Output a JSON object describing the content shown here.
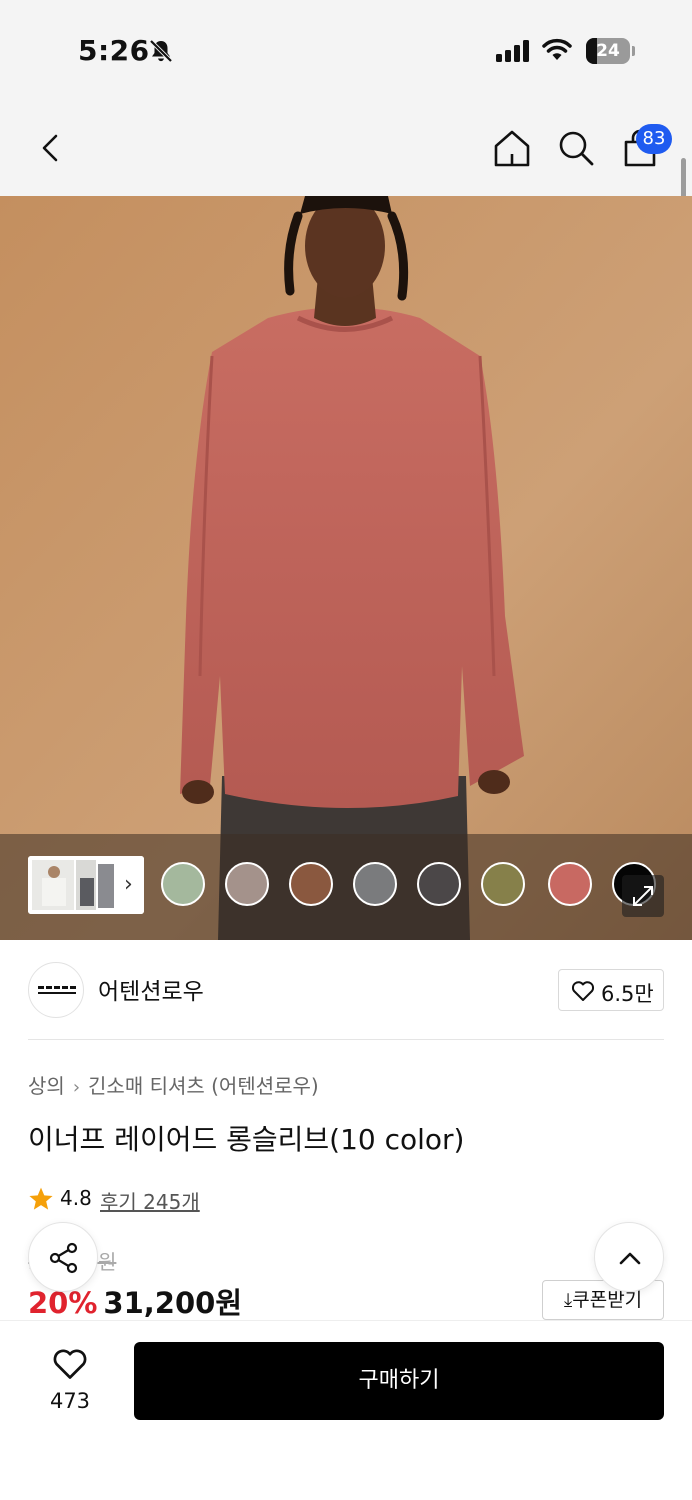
{
  "status_bar": {
    "time": "5:26",
    "battery": "24",
    "battery_level": 0.24
  },
  "nav": {
    "cart_count": "83",
    "badge_color": "#1f5bf0"
  },
  "gallery": {
    "swatches": [
      {
        "color": "#a4b89d"
      },
      {
        "color": "#a4928b"
      },
      {
        "color": "#8a583f"
      },
      {
        "color": "#7a7b7d"
      },
      {
        "color": "#4b4748"
      },
      {
        "color": "#86804a"
      },
      {
        "color": "#c86962"
      },
      {
        "color": "#050505"
      }
    ]
  },
  "brand": {
    "name": "어텐션로우",
    "logo_text": "ATTENTIONROW",
    "likes": "6.5만"
  },
  "product": {
    "breadcrumb": [
      "상의",
      "긴소매 티셔츠 (어텐션로우)"
    ],
    "title": "이너프 레이어드 롱슬리브(10 color)",
    "rating": "4.8",
    "reviews": "후기 245개",
    "original_price": "39,000원",
    "discount": "20%",
    "price": "31,200원",
    "coupon_label": "쿠폰받기"
  },
  "bottom_bar": {
    "wish_count": "473",
    "buy_label": "구매하기"
  }
}
